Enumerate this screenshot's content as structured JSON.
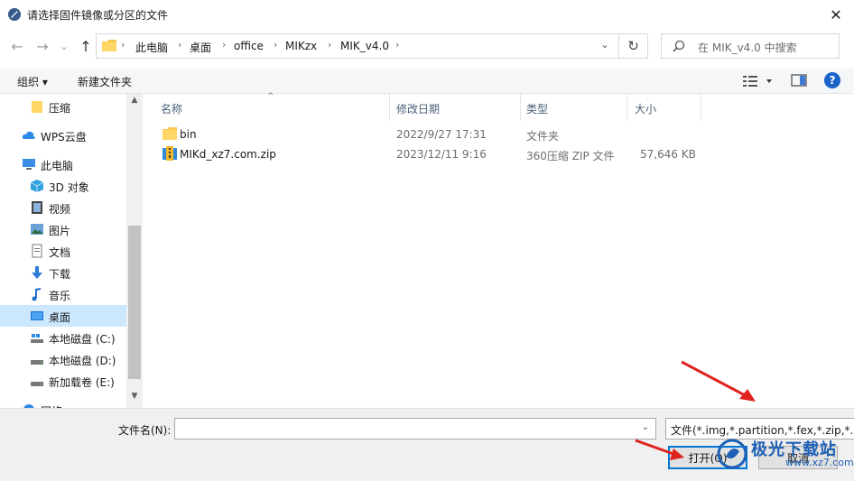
{
  "window": {
    "title": "请选择固件镜像或分区的文件",
    "close_glyph": "✕"
  },
  "nav": {
    "back_glyph": "←",
    "forward_glyph": "→",
    "recent_glyph": "⌄",
    "up_glyph": "↑",
    "breadcrumbs": [
      "此电脑",
      "桌面",
      "office",
      "MIKzx",
      "MIK_v4.0"
    ],
    "refresh_glyph": "↻",
    "search_placeholder": "在 MIK_v4.0 中搜索"
  },
  "toolbar": {
    "organize": "组织 ▾",
    "new_folder": "新建文件夹",
    "help": "?"
  },
  "sidebar": {
    "items": [
      {
        "label": "压缩",
        "icon": "folder-icon",
        "indent": 1
      },
      {
        "label": "WPS云盘",
        "icon": "cloud-icon",
        "indent": 0
      },
      {
        "label": "此电脑",
        "icon": "computer-icon",
        "indent": 0
      },
      {
        "label": "3D 对象",
        "icon": "cube-icon",
        "indent": 1
      },
      {
        "label": "视频",
        "icon": "video-icon",
        "indent": 1
      },
      {
        "label": "图片",
        "icon": "picture-icon",
        "indent": 1
      },
      {
        "label": "文档",
        "icon": "document-icon",
        "indent": 1
      },
      {
        "label": "下载",
        "icon": "download-icon",
        "indent": 1
      },
      {
        "label": "音乐",
        "icon": "music-icon",
        "indent": 1
      },
      {
        "label": "桌面",
        "icon": "desktop-icon",
        "indent": 1,
        "selected": true
      },
      {
        "label": "本地磁盘 (C:)",
        "icon": "drive-c-icon",
        "indent": 1
      },
      {
        "label": "本地磁盘 (D:)",
        "icon": "drive-icon",
        "indent": 1
      },
      {
        "label": "新加载卷 (E:)",
        "icon": "drive-icon",
        "indent": 1
      },
      {
        "label": "网络",
        "icon": "network-icon",
        "indent": 0
      }
    ]
  },
  "filelist": {
    "columns": [
      "名称",
      "修改日期",
      "类型",
      "大小"
    ],
    "rows": [
      {
        "name": "bin",
        "date": "2022/9/27 17:31",
        "type": "文件夹",
        "size": "",
        "icon": "folder-icon"
      },
      {
        "name": "MIKd_xz7.com.zip",
        "date": "2023/12/11 9:16",
        "type": "360压缩 ZIP 文件",
        "size": "57,646 KB",
        "icon": "zip-icon"
      }
    ]
  },
  "bottom": {
    "filename_label": "文件名(N):",
    "filename_value": "",
    "filter_value": "文件(*.img,*.partition,*.fex,*.zip,*.dat",
    "open": "打开(O)",
    "cancel": "取消"
  },
  "watermark": {
    "text": "极光下载站",
    "url": "www.xz7.com"
  },
  "colors": {
    "accent": "#0078d7",
    "selected": "#cce8ff",
    "arrow": "#e0221f"
  }
}
